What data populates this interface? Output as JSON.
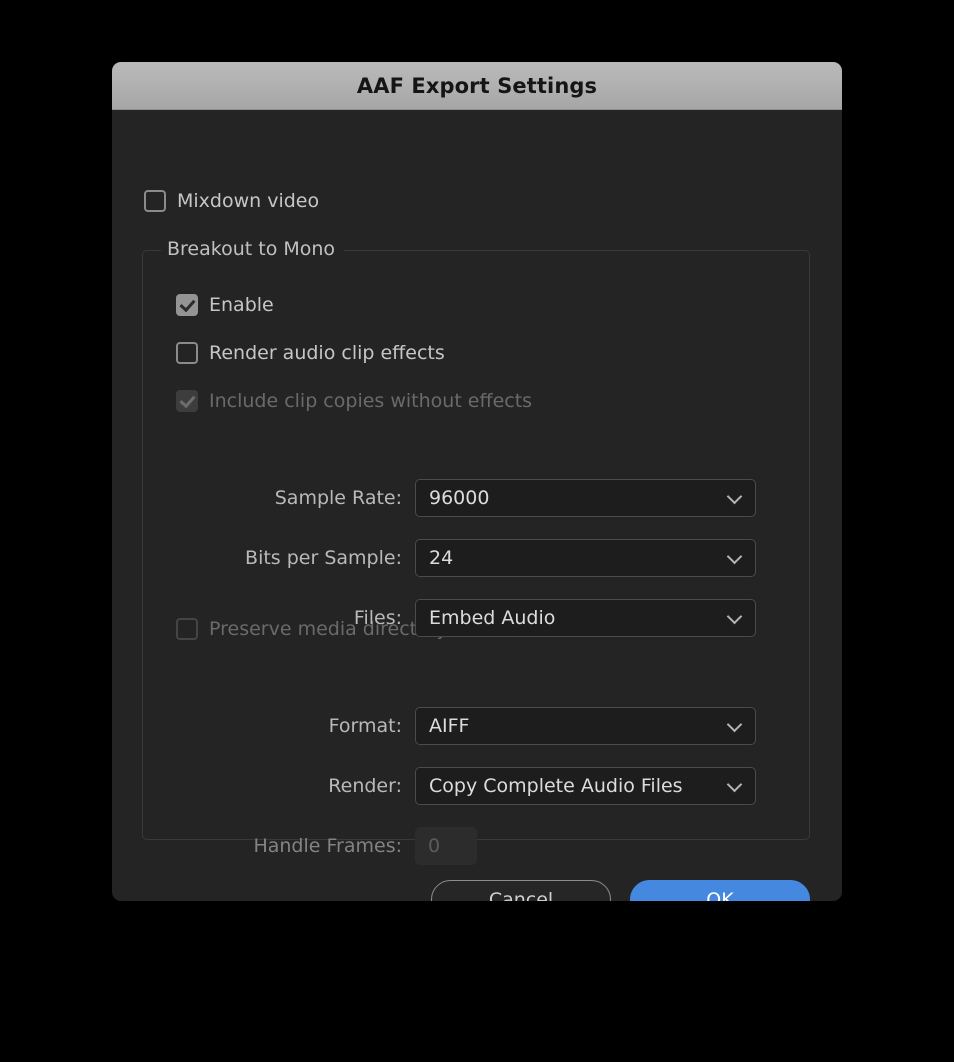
{
  "dialog": {
    "title": "AAF Export Settings"
  },
  "mixdown": {
    "label": "Mixdown video",
    "checked": false
  },
  "group": {
    "legend": "Breakout to Mono",
    "checkboxes": [
      {
        "label": "Enable",
        "checked": true,
        "disabled": false
      },
      {
        "label": "Render audio clip effects",
        "checked": false,
        "disabled": false
      },
      {
        "label": "Include clip copies without effects",
        "checked": true,
        "disabled": true
      },
      {
        "label": "Preserve media directory name",
        "checked": false,
        "disabled": true
      }
    ],
    "fields": [
      {
        "label": "Sample Rate:",
        "value": "96000",
        "type": "select",
        "disabled": false
      },
      {
        "label": "Bits per Sample:",
        "value": "24",
        "type": "select",
        "disabled": false
      },
      {
        "label": "Files:",
        "value": "Embed Audio",
        "type": "select",
        "disabled": false
      },
      {
        "label": "Format:",
        "value": "AIFF",
        "type": "select",
        "disabled": false
      },
      {
        "label": "Render:",
        "value": "Copy Complete Audio Files",
        "type": "select",
        "disabled": false
      },
      {
        "label": "Handle Frames:",
        "value": "0",
        "type": "text",
        "disabled": true
      }
    ]
  },
  "footer": {
    "cancel_label": "Cancel",
    "ok_label": "OK"
  },
  "colors": {
    "accent": "#4588e0",
    "dialog_bg": "#242424",
    "titlebar": "#b2b2b2",
    "field_bg": "#1d1d1d",
    "field_border": "#4b4b4b",
    "label_text": "#b9b9b9",
    "disabled_text": "#6a6a6a"
  },
  "icons": {
    "chevron_down": "chevron-down-icon",
    "check": "check-icon"
  }
}
